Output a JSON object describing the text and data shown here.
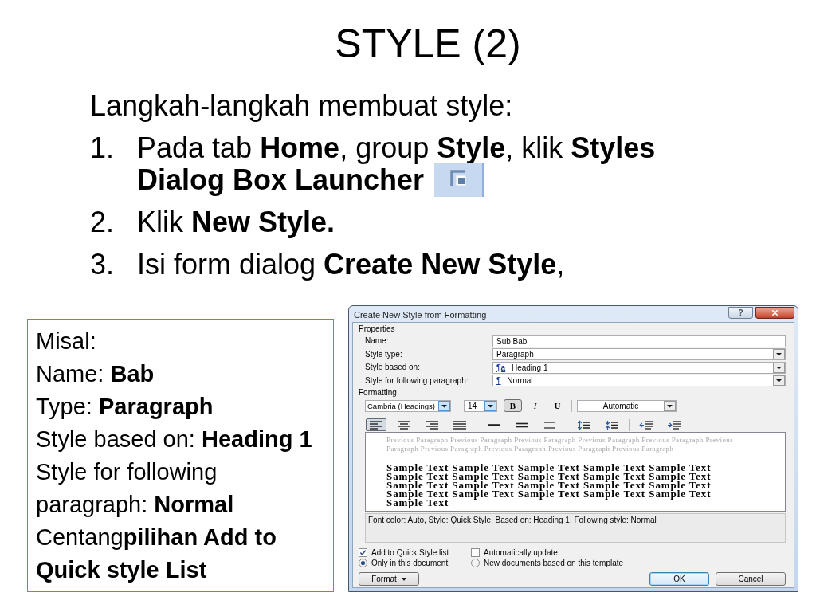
{
  "slide": {
    "title": "STYLE (2)",
    "intro": "Langkah-langkah membuat style:",
    "steps": [
      {
        "number": "1.",
        "lines": [
          "Pada tab **Home**, group **Style**, klik **Styles**",
          "**Dialog Box Launcher**"
        ],
        "launcher_icon": true
      },
      {
        "number": "2.",
        "lines": [
          "Klik **New Style.**"
        ],
        "launcher_icon": false
      },
      {
        "number": "3.",
        "lines": [
          "Isi form dialog **Create New Style**,"
        ],
        "launcher_icon": false
      }
    ]
  },
  "example": {
    "lines": [
      "Misal:",
      "Name: **Bab**",
      "Type: **Paragraph**",
      "Style based on: **Heading 1**",
      "Style for following paragraph: **Normal**",
      "Centang**pilihan Add to Quick style List**"
    ]
  },
  "dialog": {
    "title": "Create New Style from Formatting",
    "help_button": "?",
    "properties": {
      "label": "Properties",
      "fields": [
        {
          "label": "Name:",
          "kind": "text",
          "value": "Sub Bab"
        },
        {
          "label": "Style type:",
          "kind": "dropdown",
          "value": "Paragraph"
        },
        {
          "label": "Style based on:",
          "kind": "dropdown",
          "marker": "¶a",
          "value": "Heading 1"
        },
        {
          "label": "Style for following paragraph:",
          "kind": "dropdown",
          "marker": "¶",
          "value": "Normal"
        }
      ]
    },
    "formatting": {
      "label": "Formatting",
      "font": "Cambria (Headings)",
      "size": "14",
      "styles": [
        {
          "label": "B",
          "kind": "bold",
          "selected": true
        },
        {
          "label": "I",
          "kind": "italic",
          "selected": false
        },
        {
          "label": "U",
          "kind": "underline",
          "selected": false
        }
      ],
      "color_dropdown": "Automatic",
      "paragraph_tool_groups": [
        [
          {
            "kind": "align-left",
            "selected": true
          },
          {
            "kind": "align-center",
            "selected": false
          },
          {
            "kind": "align-right",
            "selected": false
          },
          {
            "kind": "justify",
            "selected": false
          }
        ],
        [
          {
            "kind": "line-spacing-single",
            "selected": false
          },
          {
            "kind": "line-spacing-one-half",
            "selected": false
          },
          {
            "kind": "line-spacing-double",
            "selected": false
          }
        ],
        [
          {
            "kind": "space-increase",
            "selected": false
          },
          {
            "kind": "space-decrease",
            "selected": false
          }
        ],
        [
          {
            "kind": "indent-decrease",
            "selected": false
          },
          {
            "kind": "indent-increase",
            "selected": false
          }
        ]
      ]
    },
    "preview": {
      "previous_text": "Previous Paragraph Previous Paragraph Previous Paragraph Previous Paragraph Previous Paragraph Previous Paragraph Previous Paragraph Previous Paragraph Previous Paragraph Previous Paragraph",
      "sample_text": "Sample Text Sample Text Sample Text Sample Text Sample Text Sample Text Sample Text Sample Text Sample Text Sample Text Sample Text Sample Text Sample Text Sample Text Sample Text Sample Text Sample Text Sample Text Sample Text Sample Text Sample Text"
    },
    "description": "Font color: Auto, Style: Quick Style, Based on: Heading 1, Following style: Normal",
    "options": [
      {
        "label": "Add to Quick Style list",
        "checked": true
      },
      {
        "label": "Automatically update",
        "checked": false
      }
    ],
    "scope": [
      {
        "label": "Only in this document",
        "selected": true
      },
      {
        "label": "New documents based on this template",
        "selected": false
      }
    ],
    "buttons": [
      {
        "label": "Format",
        "kind": "menu"
      },
      {
        "label": "OK",
        "kind": "default"
      },
      {
        "label": "Cancel",
        "kind": "normal"
      }
    ]
  }
}
